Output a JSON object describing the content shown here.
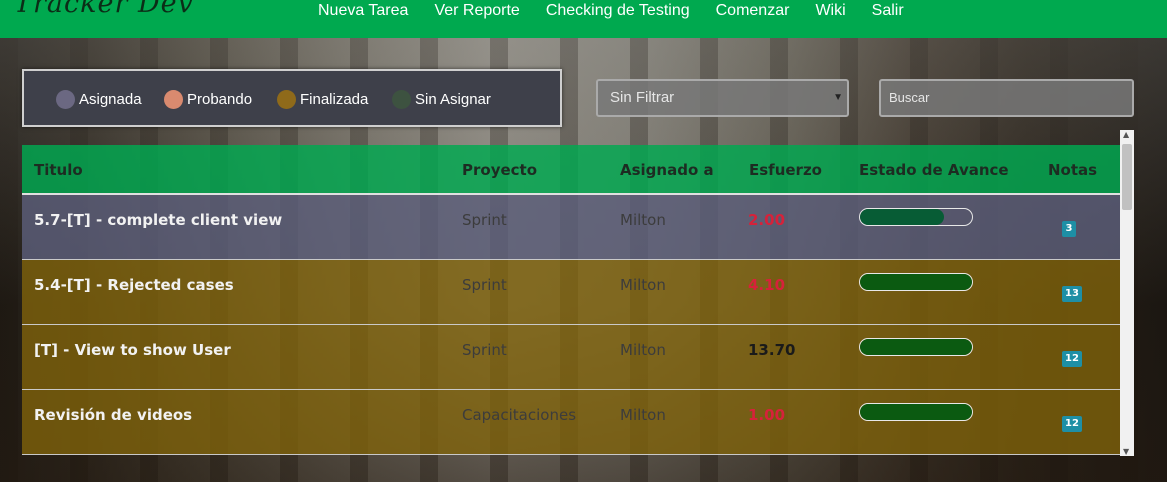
{
  "app": {
    "brand": "Tracker Dev"
  },
  "nav": {
    "links": [
      "Nueva Tarea",
      "Ver Reporte",
      "Checking de Testing",
      "Comenzar",
      "Wiki",
      "Salir"
    ]
  },
  "legend": {
    "items": [
      {
        "label": "Asignada",
        "color": "#6b6882"
      },
      {
        "label": "Probando",
        "color": "#d98a6f"
      },
      {
        "label": "Finalizada",
        "color": "#8f6a1a"
      },
      {
        "label": "Sin Asignar",
        "color": "#3d5240"
      }
    ]
  },
  "filter": {
    "selected": "Sin Filtrar"
  },
  "search": {
    "placeholder": "Buscar"
  },
  "table": {
    "headers": [
      "Titulo",
      "Proyecto",
      "Asignado a",
      "Esfuerzo",
      "Estado de Avance",
      "Notas"
    ],
    "rows": [
      {
        "title": "5.7-[T] - complete client view",
        "project": "Sprint",
        "assigned": "Milton",
        "effort": "2.00",
        "effort_color": "red",
        "progress": 0.75,
        "notes": "3",
        "status": "Asignada"
      },
      {
        "title": "5.4-[T] - Rejected cases",
        "project": "Sprint",
        "assigned": "Milton",
        "effort": "4.10",
        "effort_color": "red",
        "progress": 1.0,
        "notes": "13",
        "status": "Finalizada"
      },
      {
        "title": "[T] - View to show User",
        "project": "Sprint",
        "assigned": "Milton",
        "effort": "13.70",
        "effort_color": "dark",
        "progress": 1.0,
        "notes": "12",
        "status": "Finalizada"
      },
      {
        "title": "Revisión de videos",
        "project": "Capacitaciones",
        "assigned": "Milton",
        "effort": "1.00",
        "effort_color": "red",
        "progress": 1.0,
        "notes": "12",
        "status": "Finalizada"
      }
    ]
  }
}
